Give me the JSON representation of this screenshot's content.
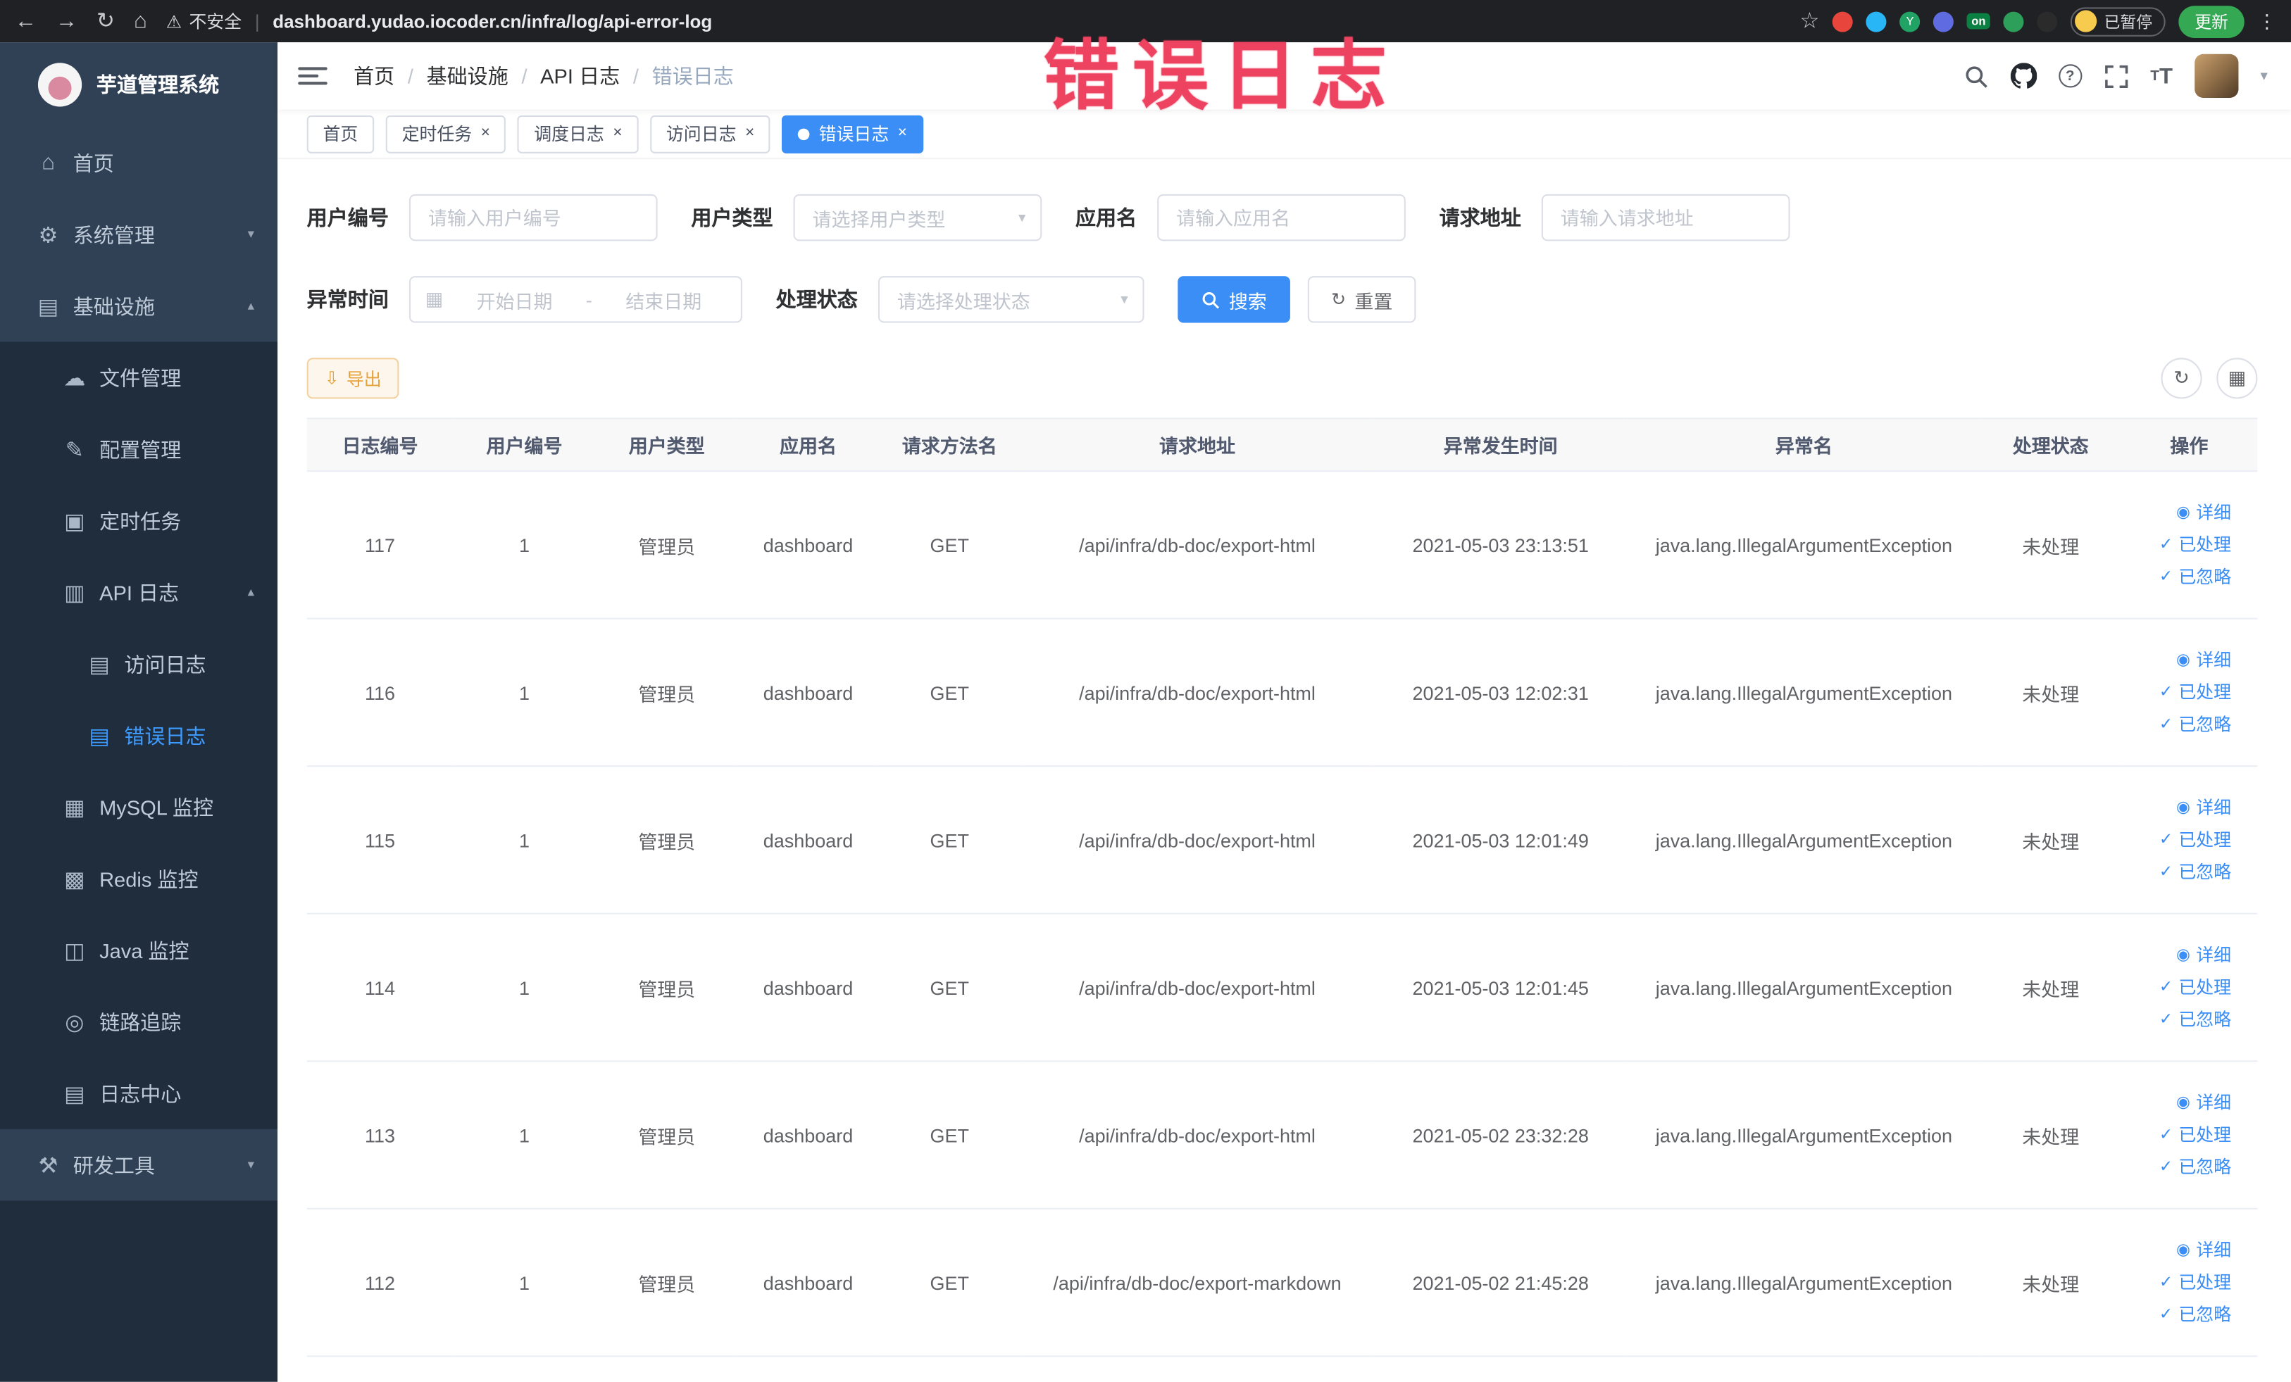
{
  "browser": {
    "security_label": "不安全",
    "url": "dashboard.yudao.iocoder.cn/infra/log/api-error-log",
    "on_badge": "on",
    "paused_badge": "已暂停",
    "update_button": "更新"
  },
  "annotation": {
    "text": "错误日志"
  },
  "sidebar": {
    "logo_title": "芋道管理系统",
    "items": [
      {
        "label": "首页"
      },
      {
        "label": "系统管理"
      },
      {
        "label": "基础设施"
      },
      {
        "label": "文件管理"
      },
      {
        "label": "配置管理"
      },
      {
        "label": "定时任务"
      },
      {
        "label": "API 日志"
      },
      {
        "label": "访问日志"
      },
      {
        "label": "错误日志"
      },
      {
        "label": "MySQL 监控"
      },
      {
        "label": "Redis 监控"
      },
      {
        "label": "Java 监控"
      },
      {
        "label": "链路追踪"
      },
      {
        "label": "日志中心"
      },
      {
        "label": "研发工具"
      }
    ]
  },
  "header": {
    "breadcrumbs": [
      "首页",
      "基础设施",
      "API 日志",
      "错误日志"
    ]
  },
  "tabs": [
    {
      "label": "首页"
    },
    {
      "label": "定时任务"
    },
    {
      "label": "调度日志"
    },
    {
      "label": "访问日志"
    },
    {
      "label": "错误日志"
    }
  ],
  "filters": {
    "user_id_label": "用户编号",
    "user_id_placeholder": "请输入用户编号",
    "user_type_label": "用户类型",
    "user_type_placeholder": "请选择用户类型",
    "app_name_label": "应用名",
    "app_name_placeholder": "请输入应用名",
    "request_url_label": "请求地址",
    "request_url_placeholder": "请输入请求地址",
    "exception_time_label": "异常时间",
    "date_start_placeholder": "开始日期",
    "date_separator": "-",
    "date_end_placeholder": "结束日期",
    "process_status_label": "处理状态",
    "process_status_placeholder": "请选择处理状态",
    "search_button": "搜索",
    "reset_button": "重置"
  },
  "toolbar": {
    "export_button": "导出"
  },
  "table": {
    "columns": [
      "日志编号",
      "用户编号",
      "用户类型",
      "应用名",
      "请求方法名",
      "请求地址",
      "异常发生时间",
      "异常名",
      "处理状态",
      "操作"
    ],
    "action_labels": {
      "detail": "详细",
      "processed": "已处理",
      "ignored": "已忽略"
    },
    "rows": [
      {
        "id": "117",
        "user_id": "1",
        "user_type": "管理员",
        "app": "dashboard",
        "method": "GET",
        "url": "/api/infra/db-doc/export-html",
        "time": "2021-05-03 23:13:51",
        "exception": "java.lang.IllegalArgumentException",
        "status": "未处理"
      },
      {
        "id": "116",
        "user_id": "1",
        "user_type": "管理员",
        "app": "dashboard",
        "method": "GET",
        "url": "/api/infra/db-doc/export-html",
        "time": "2021-05-03 12:02:31",
        "exception": "java.lang.IllegalArgumentException",
        "status": "未处理"
      },
      {
        "id": "115",
        "user_id": "1",
        "user_type": "管理员",
        "app": "dashboard",
        "method": "GET",
        "url": "/api/infra/db-doc/export-html",
        "time": "2021-05-03 12:01:49",
        "exception": "java.lang.IllegalArgumentException",
        "status": "未处理"
      },
      {
        "id": "114",
        "user_id": "1",
        "user_type": "管理员",
        "app": "dashboard",
        "method": "GET",
        "url": "/api/infra/db-doc/export-html",
        "time": "2021-05-03 12:01:45",
        "exception": "java.lang.IllegalArgumentException",
        "status": "未处理"
      },
      {
        "id": "113",
        "user_id": "1",
        "user_type": "管理员",
        "app": "dashboard",
        "method": "GET",
        "url": "/api/infra/db-doc/export-html",
        "time": "2021-05-02 23:32:28",
        "exception": "java.lang.IllegalArgumentException",
        "status": "未处理"
      },
      {
        "id": "112",
        "user_id": "1",
        "user_type": "管理员",
        "app": "dashboard",
        "method": "GET",
        "url": "/api/infra/db-doc/export-markdown",
        "time": "2021-05-02 21:45:28",
        "exception": "java.lang.IllegalArgumentException",
        "status": "未处理"
      }
    ]
  }
}
